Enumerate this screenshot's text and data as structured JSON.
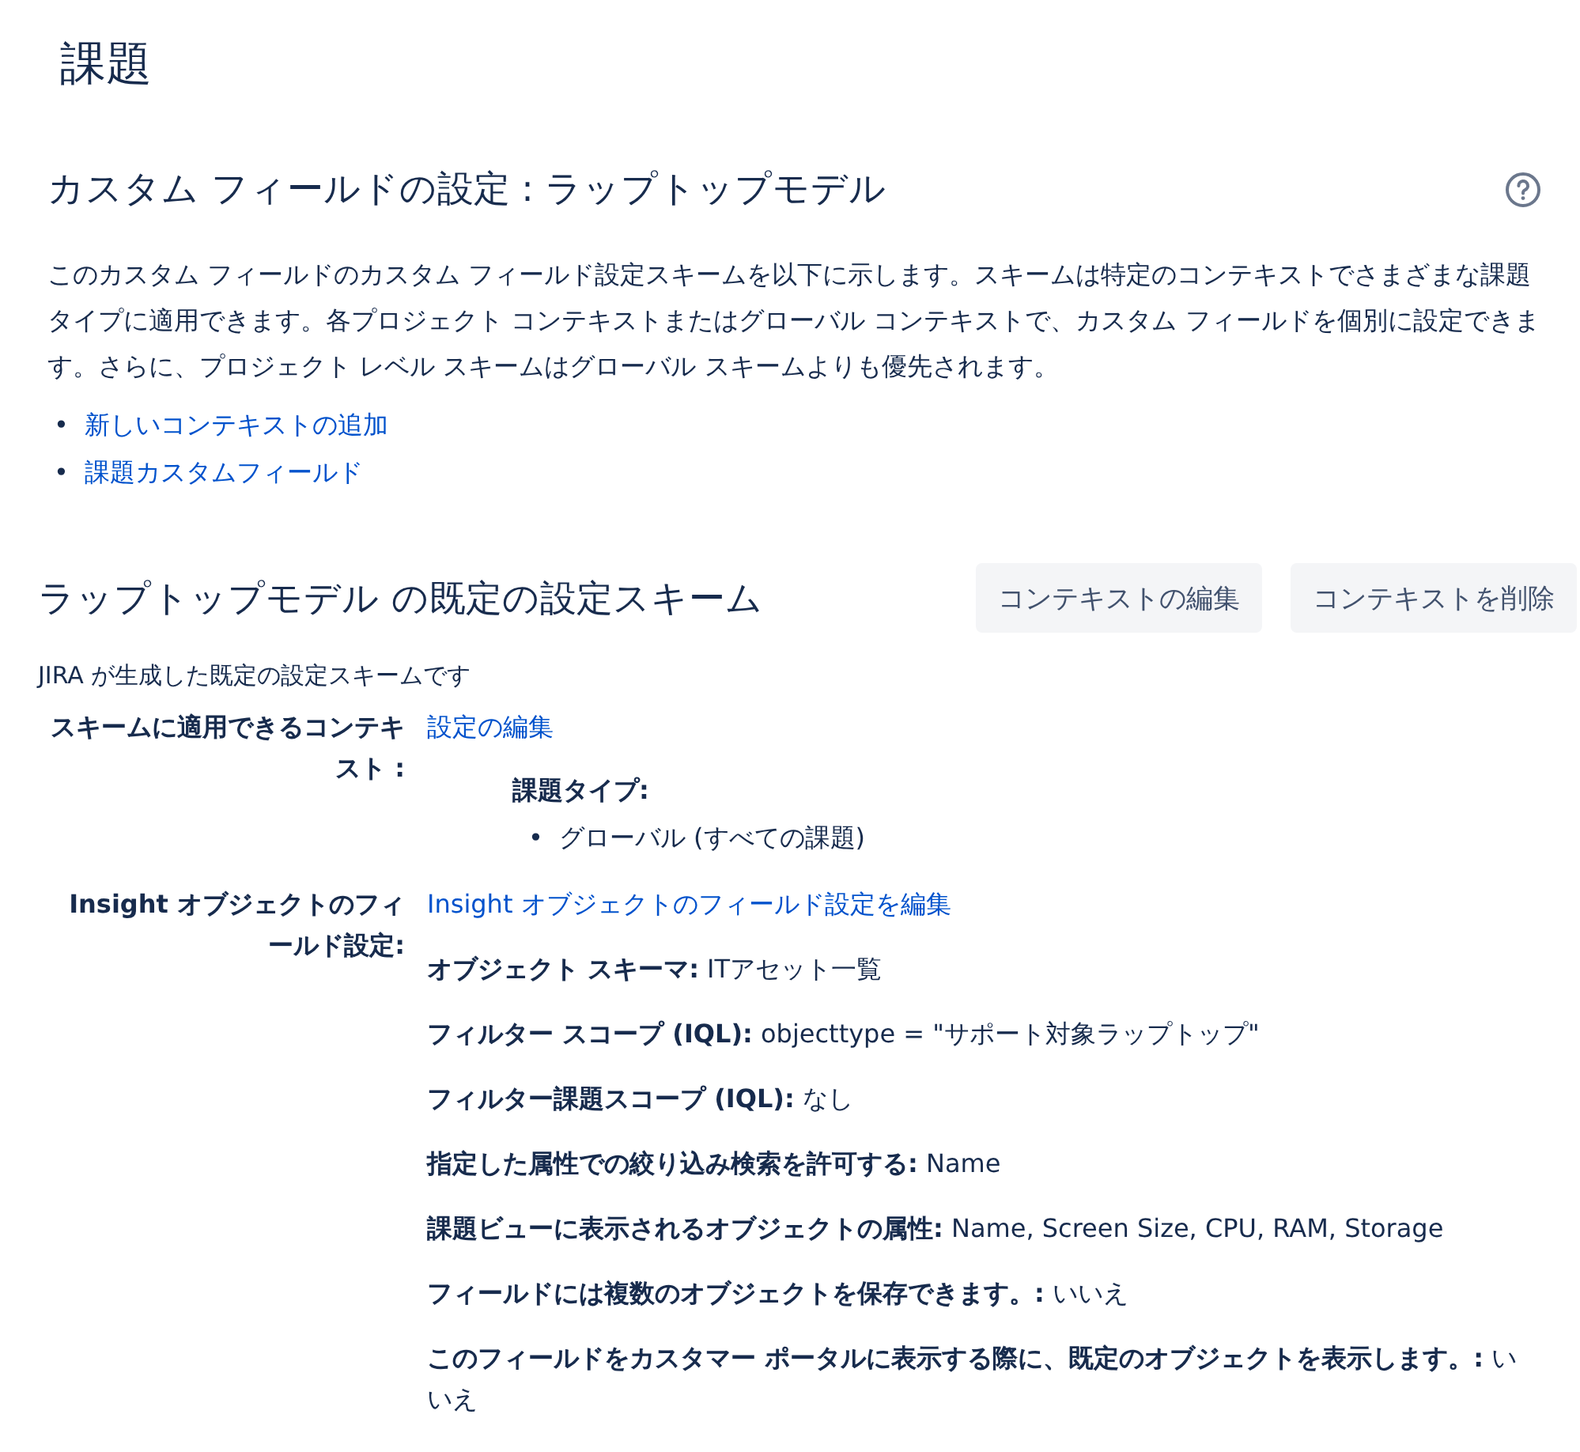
{
  "page_title": "課題",
  "field_config": {
    "title": "カスタム フィールドの設定 : ラップトップモデル",
    "description": "このカスタム フィールドのカスタム フィールド設定スキームを以下に示します。スキームは特定のコンテキストでさまざまな課題タイプに適用できます。各プロジェクト コンテキストまたはグローバル コンテキストで、カスタム フィールドを個別に設定できます。さらに、プロジェクト レベル スキームはグローバル スキームよりも優先されます。",
    "links": [
      {
        "bullet": "•",
        "label": "新しいコンテキストの追加"
      },
      {
        "bullet": "•",
        "label": "課題カスタムフィールド"
      }
    ]
  },
  "scheme": {
    "title": "ラップトップモデル の既定の設定スキーム",
    "buttons": [
      "コンテキストの編集",
      "コンテキストを削除"
    ],
    "note": "JIRA が生成した既定の設定スキームです",
    "context": {
      "label": "スキームに適用できるコンテキスト :",
      "link": "設定の編集",
      "issue_types_label": "課題タイプ:",
      "issue_types": [
        {
          "bullet": "•",
          "label": "グローバル (すべての課題)"
        }
      ]
    },
    "insight": {
      "label": "Insight オブジェクトのフィールド設定:",
      "link": "Insight オブジェクトのフィールド設定を編集",
      "properties": [
        "**オブジェクト スキーマ:** ITアセット一覧",
        "**フィルター スコープ (IQL):** objecttype = \"サポート対象ラップトップ\"",
        "**フィルター課題スコープ (IQL):** なし",
        "**指定した属性での絞り込み検索を許可する:** Name",
        "**課題ビューに表示されるオブジェクトの属性:** Name, Screen Size, CPU, RAM, Storage",
        "**フィールドには複数のオブジェクトを保存できます。:** いいえ",
        "**このフィールドをカスタマー ポータルに表示する際に、既定のオブジェクトを表示します。:** いいえ"
      ]
    }
  }
}
